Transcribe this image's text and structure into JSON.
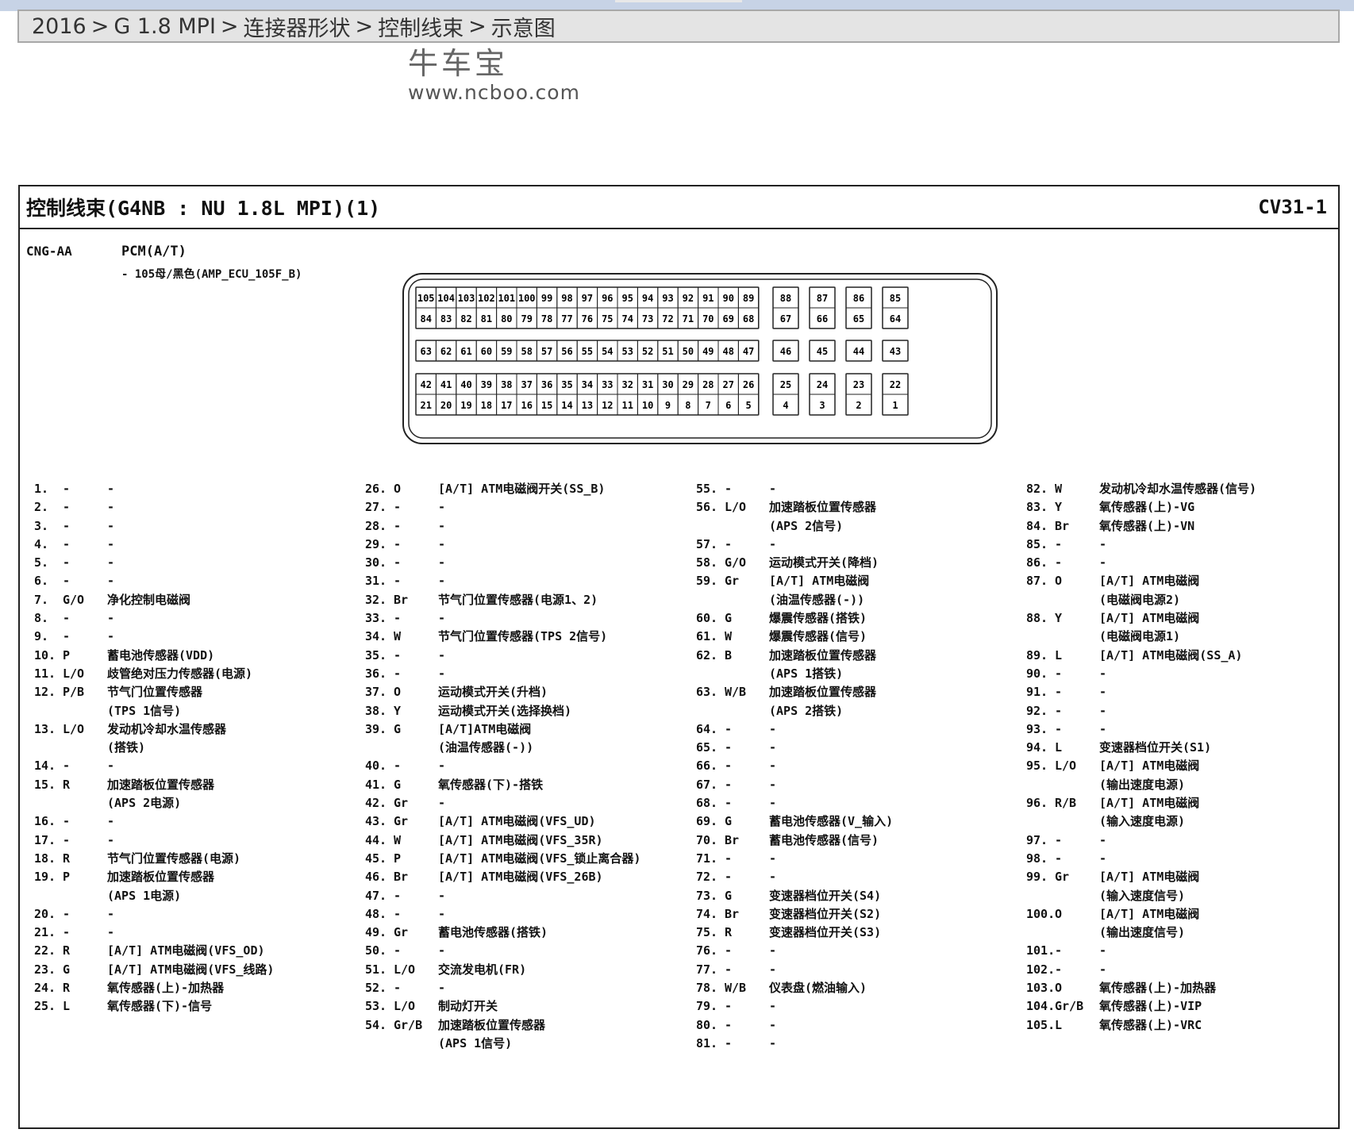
{
  "breadcrumb": [
    "2016",
    "G 1.8 MPI",
    "连接器形状",
    "控制线束",
    "示意图"
  ],
  "breadcrumb_sep": ">",
  "watermark": {
    "name": "牛车宝",
    "url": "www.ncboo.com"
  },
  "document": {
    "title": "控制线束(G4NB : NU 1.8L MPI)(1)",
    "code": "CV31-1",
    "connector_id": "CNG-AA",
    "connector_name": "PCM(A/T)",
    "connector_desc": "- 105母/黑色(AMP_ECU_105F_B)"
  },
  "connector_pins": {
    "row1": [
      "105",
      "104",
      "103",
      "102",
      "101",
      "100",
      "99",
      "98",
      "97",
      "96",
      "95",
      "94",
      "93",
      "92",
      "91",
      "90",
      "89"
    ],
    "row2": [
      "84",
      "83",
      "82",
      "81",
      "80",
      "79",
      "78",
      "77",
      "76",
      "75",
      "74",
      "73",
      "72",
      "71",
      "70",
      "69",
      "68"
    ],
    "row3": [
      "63",
      "62",
      "61",
      "60",
      "59",
      "58",
      "57",
      "56",
      "55",
      "54",
      "53",
      "52",
      "51",
      "50",
      "49",
      "48",
      "47"
    ],
    "row4": [
      "42",
      "41",
      "40",
      "39",
      "38",
      "37",
      "36",
      "35",
      "34",
      "33",
      "32",
      "31",
      "30",
      "29",
      "28",
      "27",
      "26"
    ],
    "row5": [
      "21",
      "20",
      "19",
      "18",
      "17",
      "16",
      "15",
      "14",
      "13",
      "12",
      "11",
      "10",
      "9",
      "8",
      "7",
      "6",
      "5"
    ],
    "side_top": [
      "88",
      "87",
      "86",
      "85"
    ],
    "side_top2": [
      "67",
      "66",
      "65",
      "64"
    ],
    "side_mid": [
      "46",
      "45",
      "44",
      "43"
    ],
    "side_bot": [
      "25",
      "24",
      "23",
      "22"
    ],
    "side_bot2": [
      "4",
      "3",
      "2",
      "1"
    ]
  },
  "pins": [
    [
      {
        "n": "1.",
        "c": "-",
        "d": "-"
      },
      {
        "n": "2.",
        "c": "-",
        "d": "-"
      },
      {
        "n": "3.",
        "c": "-",
        "d": "-"
      },
      {
        "n": "4.",
        "c": "-",
        "d": "-"
      },
      {
        "n": "5.",
        "c": "-",
        "d": "-"
      },
      {
        "n": "6.",
        "c": "-",
        "d": "-"
      },
      {
        "n": "7.",
        "c": "G/O",
        "d": "净化控制电磁阀"
      },
      {
        "n": "8.",
        "c": "-",
        "d": "-"
      },
      {
        "n": "9.",
        "c": "-",
        "d": "-"
      },
      {
        "n": "10.",
        "c": "P",
        "d": "蓄电池传感器(VDD)"
      },
      {
        "n": "11.",
        "c": "L/O",
        "d": "歧管绝对压力传感器(电源)"
      },
      {
        "n": "12.",
        "c": "P/B",
        "d": "节气门位置传感器\n(TPS 1信号)"
      },
      {
        "n": "13.",
        "c": "L/O",
        "d": "发动机冷却水温传感器\n(搭铁)"
      },
      {
        "n": "14.",
        "c": "-",
        "d": "-"
      },
      {
        "n": "15.",
        "c": "R",
        "d": "加速踏板位置传感器\n(APS 2电源)"
      },
      {
        "n": "16.",
        "c": "-",
        "d": "-"
      },
      {
        "n": "17.",
        "c": "-",
        "d": "-"
      },
      {
        "n": "18.",
        "c": "R",
        "d": "节气门位置传感器(电源)"
      },
      {
        "n": "19.",
        "c": "P",
        "d": "加速踏板位置传感器\n(APS 1电源)"
      },
      {
        "n": "20.",
        "c": "-",
        "d": "-"
      },
      {
        "n": "21.",
        "c": "-",
        "d": "-"
      },
      {
        "n": "22.",
        "c": "R",
        "d": "[A/T] ATM电磁阀(VFS_OD)"
      },
      {
        "n": "23.",
        "c": "G",
        "d": "[A/T] ATM电磁阀(VFS_线路)"
      },
      {
        "n": "24.",
        "c": "R",
        "d": "氧传感器(上)-加热器"
      },
      {
        "n": "25.",
        "c": "L",
        "d": "氧传感器(下)-信号"
      }
    ],
    [
      {
        "n": "26.",
        "c": "O",
        "d": "[A/T] ATM电磁阀开关(SS_B)"
      },
      {
        "n": "27.",
        "c": "-",
        "d": "-"
      },
      {
        "n": "28.",
        "c": "-",
        "d": "-"
      },
      {
        "n": "29.",
        "c": "-",
        "d": "-"
      },
      {
        "n": "30.",
        "c": "-",
        "d": "-"
      },
      {
        "n": "31.",
        "c": "-",
        "d": "-"
      },
      {
        "n": "32.",
        "c": "Br",
        "d": "节气门位置传感器(电源1、2)"
      },
      {
        "n": "33.",
        "c": "-",
        "d": "-"
      },
      {
        "n": "34.",
        "c": "W",
        "d": "节气门位置传感器(TPS 2信号)"
      },
      {
        "n": "35.",
        "c": "-",
        "d": "-"
      },
      {
        "n": "36.",
        "c": "-",
        "d": "-"
      },
      {
        "n": "37.",
        "c": "O",
        "d": "运动模式开关(升档)"
      },
      {
        "n": "38.",
        "c": "Y",
        "d": "运动模式开关(选择换档)"
      },
      {
        "n": "39.",
        "c": "G",
        "d": "[A/T]ATM电磁阀\n(油温传感器(-))"
      },
      {
        "n": "40.",
        "c": "-",
        "d": "-"
      },
      {
        "n": "41.",
        "c": "G",
        "d": "氧传感器(下)-搭铁"
      },
      {
        "n": "42.",
        "c": "Gr",
        "d": "-"
      },
      {
        "n": "43.",
        "c": "Gr",
        "d": "[A/T] ATM电磁阀(VFS_UD)"
      },
      {
        "n": "44.",
        "c": "W",
        "d": "[A/T] ATM电磁阀(VFS_35R)"
      },
      {
        "n": "45.",
        "c": "P",
        "d": "[A/T] ATM电磁阀(VFS_锁止离合器)"
      },
      {
        "n": "46.",
        "c": "Br",
        "d": "[A/T] ATM电磁阀(VFS_26B)"
      },
      {
        "n": "47.",
        "c": "-",
        "d": "-"
      },
      {
        "n": "48.",
        "c": "-",
        "d": "-"
      },
      {
        "n": "49.",
        "c": "Gr",
        "d": "蓄电池传感器(搭铁)"
      },
      {
        "n": "50.",
        "c": "-",
        "d": "-"
      },
      {
        "n": "51.",
        "c": "L/O",
        "d": "交流发电机(FR)"
      },
      {
        "n": "52.",
        "c": "-",
        "d": "-"
      },
      {
        "n": "53.",
        "c": "L/O",
        "d": "制动灯开关"
      },
      {
        "n": "54.",
        "c": "Gr/B",
        "d": "加速踏板位置传感器\n(APS 1信号)"
      }
    ],
    [
      {
        "n": "55.",
        "c": "-",
        "d": "-"
      },
      {
        "n": "56.",
        "c": "L/O",
        "d": "加速踏板位置传感器\n(APS 2信号)"
      },
      {
        "n": "57.",
        "c": "-",
        "d": "-"
      },
      {
        "n": "58.",
        "c": "G/O",
        "d": "运动模式开关(降档)"
      },
      {
        "n": "59.",
        "c": "Gr",
        "d": "[A/T] ATM电磁阀\n(油温传感器(-))"
      },
      {
        "n": "60.",
        "c": "G",
        "d": "爆震传感器(搭铁)"
      },
      {
        "n": "61.",
        "c": "W",
        "d": "爆震传感器(信号)"
      },
      {
        "n": "62.",
        "c": "B",
        "d": "加速踏板位置传感器\n(APS 1搭铁)"
      },
      {
        "n": "63.",
        "c": "W/B",
        "d": "加速踏板位置传感器\n(APS 2搭铁)"
      },
      {
        "n": "64.",
        "c": "-",
        "d": "-"
      },
      {
        "n": "65.",
        "c": "-",
        "d": "-"
      },
      {
        "n": "66.",
        "c": "-",
        "d": "-"
      },
      {
        "n": "67.",
        "c": "-",
        "d": "-"
      },
      {
        "n": "68.",
        "c": "-",
        "d": "-"
      },
      {
        "n": "69.",
        "c": "G",
        "d": "蓄电池传感器(V_输入)"
      },
      {
        "n": "70.",
        "c": "Br",
        "d": "蓄电池传感器(信号)"
      },
      {
        "n": "71.",
        "c": "-",
        "d": "-"
      },
      {
        "n": "72.",
        "c": "-",
        "d": "-"
      },
      {
        "n": "73.",
        "c": "G",
        "d": "变速器档位开关(S4)"
      },
      {
        "n": "74.",
        "c": "Br",
        "d": "变速器档位开关(S2)"
      },
      {
        "n": "75.",
        "c": "R",
        "d": "变速器档位开关(S3)"
      },
      {
        "n": "76.",
        "c": "-",
        "d": "-"
      },
      {
        "n": "77.",
        "c": "-",
        "d": "-"
      },
      {
        "n": "78.",
        "c": "W/B",
        "d": "仪表盘(燃油输入)"
      },
      {
        "n": "79.",
        "c": "-",
        "d": "-"
      },
      {
        "n": "80.",
        "c": "-",
        "d": "-"
      },
      {
        "n": "81.",
        "c": "-",
        "d": "-"
      }
    ],
    [
      {
        "n": "82.",
        "c": "W",
        "d": "发动机冷却水温传感器(信号)"
      },
      {
        "n": "83.",
        "c": "Y",
        "d": "氧传感器(上)-VG"
      },
      {
        "n": "84.",
        "c": "Br",
        "d": "氧传感器(上)-VN"
      },
      {
        "n": "85.",
        "c": "-",
        "d": "-"
      },
      {
        "n": "86.",
        "c": "-",
        "d": "-"
      },
      {
        "n": "87.",
        "c": "O",
        "d": "[A/T] ATM电磁阀\n(电磁阀电源2)"
      },
      {
        "n": "88.",
        "c": "Y",
        "d": "[A/T] ATM电磁阀\n(电磁阀电源1)"
      },
      {
        "n": "89.",
        "c": "L",
        "d": "[A/T] ATM电磁阀(SS_A)"
      },
      {
        "n": "90.",
        "c": "-",
        "d": "-"
      },
      {
        "n": "91.",
        "c": "-",
        "d": "-"
      },
      {
        "n": "92.",
        "c": "-",
        "d": "-"
      },
      {
        "n": "93.",
        "c": "-",
        "d": "-"
      },
      {
        "n": "94.",
        "c": "L",
        "d": "变速器档位开关(S1)"
      },
      {
        "n": "95.",
        "c": "L/O",
        "d": "[A/T] ATM电磁阀\n(输出速度电源)"
      },
      {
        "n": "96.",
        "c": "R/B",
        "d": "[A/T] ATM电磁阀\n(输入速度电源)"
      },
      {
        "n": "97.",
        "c": "-",
        "d": "-"
      },
      {
        "n": "98.",
        "c": "-",
        "d": "-"
      },
      {
        "n": "99.",
        "c": "Gr",
        "d": "[A/T] ATM电磁阀\n(输入速度信号)"
      },
      {
        "n": "100.",
        "c": "O",
        "d": "[A/T] ATM电磁阀\n(输出速度信号)"
      },
      {
        "n": "101.",
        "c": "-",
        "d": "-"
      },
      {
        "n": "102.",
        "c": "-",
        "d": "-"
      },
      {
        "n": "103.",
        "c": "O",
        "d": "氧传感器(上)-加热器"
      },
      {
        "n": "104.",
        "c": "Gr/B",
        "d": "氧传感器(上)-VIP"
      },
      {
        "n": "105.",
        "c": "L",
        "d": "氧传感器(上)-VRC"
      }
    ]
  ]
}
